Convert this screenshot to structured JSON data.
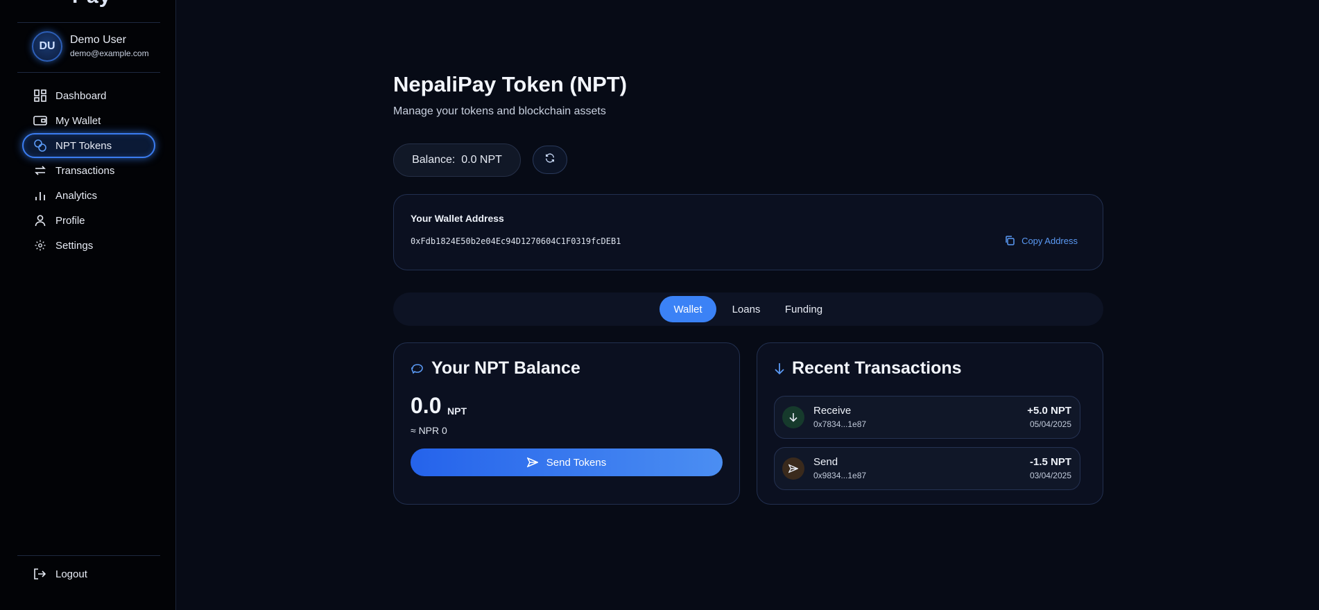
{
  "sidebar": {
    "brand_fragment": "Pay",
    "user": {
      "initials": "DU",
      "name": "Demo User",
      "email": "demo@example.com"
    },
    "items": [
      {
        "label": "Dashboard",
        "icon": "dashboard-icon",
        "active": false
      },
      {
        "label": "My Wallet",
        "icon": "wallet-icon",
        "active": false
      },
      {
        "label": "NPT Tokens",
        "icon": "coins-icon",
        "active": true
      },
      {
        "label": "Transactions",
        "icon": "transfer-icon",
        "active": false
      },
      {
        "label": "Analytics",
        "icon": "bar-chart-icon",
        "active": false
      },
      {
        "label": "Profile",
        "icon": "user-icon",
        "active": false
      },
      {
        "label": "Settings",
        "icon": "gear-icon",
        "active": false
      }
    ],
    "logout_label": "Logout"
  },
  "page": {
    "title": "NepaliPay Token (NPT)",
    "subtitle": "Manage your tokens and blockchain assets",
    "balance_label": "Balance:",
    "balance_value": "0.0 NPT"
  },
  "wallet": {
    "label": "Your Wallet Address",
    "address": "0xFdb1824E50b2e04Ec94D1270604C1F0319fcDEB1",
    "copy_label": "Copy Address"
  },
  "tabs": [
    {
      "label": "Wallet",
      "active": true
    },
    {
      "label": "Loans",
      "active": false
    },
    {
      "label": "Funding",
      "active": false
    }
  ],
  "balance_card": {
    "title": "Your NPT Balance",
    "amount": "0.0",
    "unit": "NPT",
    "npr": "≈ NPR 0",
    "send_label": "Send Tokens"
  },
  "transactions_card": {
    "title": "Recent Transactions",
    "items": [
      {
        "type": "Receive",
        "address": "0x7834...1e87",
        "amount": "+5.0 NPT",
        "date": "05/04/2025"
      },
      {
        "type": "Send",
        "address": "0x9834...1e87",
        "amount": "-1.5 NPT",
        "date": "03/04/2025"
      }
    ]
  },
  "colors": {
    "accent": "#3b82f6",
    "background": "#070b16",
    "sidebar": "#020306",
    "receive_icon_bg": "#163a2c",
    "send_icon_bg": "#3a2a1c"
  }
}
